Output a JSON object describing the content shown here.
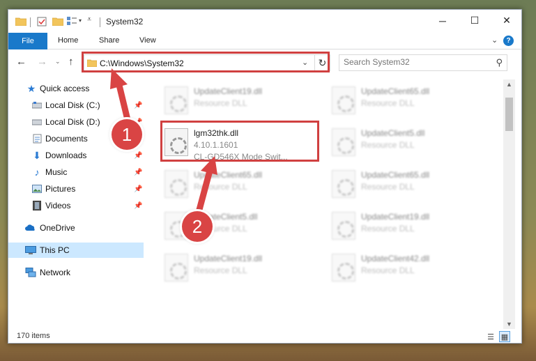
{
  "window": {
    "title": "System32"
  },
  "ribbon": {
    "tabs": [
      "File",
      "Home",
      "Share",
      "View"
    ]
  },
  "address": {
    "path": "C:\\Windows\\System32"
  },
  "search": {
    "placeholder": "Search System32"
  },
  "sidebar": {
    "items": [
      {
        "label": "Quick access",
        "icon": "star-icon"
      },
      {
        "label": "Local Disk (C:)",
        "icon": "drive-icon"
      },
      {
        "label": "Local Disk (D:)",
        "icon": "drive-icon"
      },
      {
        "label": "Documents",
        "icon": "documents-icon"
      },
      {
        "label": "Downloads",
        "icon": "downloads-icon"
      },
      {
        "label": "Music",
        "icon": "music-icon"
      },
      {
        "label": "Pictures",
        "icon": "pictures-icon"
      },
      {
        "label": "Videos",
        "icon": "videos-icon"
      },
      {
        "label": "OneDrive",
        "icon": "cloud-icon"
      },
      {
        "label": "This PC",
        "icon": "computer-icon"
      },
      {
        "label": "Network",
        "icon": "network-icon"
      }
    ]
  },
  "files": [
    {
      "name": "UpdateClient19.dll",
      "line1": "Resource DLL",
      "line2": ""
    },
    {
      "name": "UpdateClient65.dll",
      "line1": "Resource DLL",
      "line2": ""
    },
    {
      "name": "lgm32thk.dll",
      "line1": "4.10.1.1601",
      "line2": "CL-GD546X Mode Swit..."
    },
    {
      "name": "UpdateClient5.dll",
      "line1": "Resource DLL",
      "line2": ""
    },
    {
      "name": "UpdateClient65.dll",
      "line1": "Resource DLL",
      "line2": ""
    },
    {
      "name": "UpdateClient65.dll",
      "line1": "Resource DLL",
      "line2": ""
    },
    {
      "name": "UpdateClient5.dll",
      "line1": "Resource DLL",
      "line2": ""
    },
    {
      "name": "UpdateClient19.dll",
      "line1": "Resource DLL",
      "line2": ""
    },
    {
      "name": "UpdateClient19.dll",
      "line1": "Resource DLL",
      "line2": ""
    },
    {
      "name": "UpdateClient42.dll",
      "line1": "Resource DLL",
      "line2": ""
    }
  ],
  "status": {
    "count": "170 items"
  },
  "annotations": {
    "step1": "1",
    "step2": "2"
  },
  "colors": {
    "accent": "#1979ca",
    "highlight": "#d04040",
    "selected": "#cce8ff"
  }
}
